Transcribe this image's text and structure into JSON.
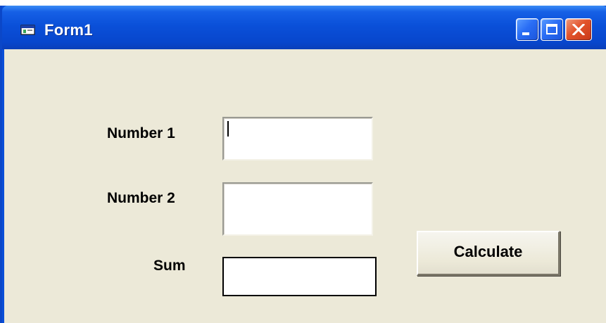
{
  "window": {
    "title": "Form1",
    "icon": "form-app-icon"
  },
  "titlebar_buttons": {
    "minimize_icon": "minimize-icon",
    "maximize_icon": "maximize-icon",
    "close_icon": "close-icon"
  },
  "form": {
    "number1_label": "Number 1",
    "number1_value": "",
    "number2_label": "Number 2",
    "number2_value": "",
    "sum_label": "Sum",
    "sum_value": "",
    "calculate_label": "Calculate"
  },
  "colors": {
    "titlebar_blue": "#0a50d9",
    "client_background": "#ece9d8",
    "close_button_red": "#e2532b"
  }
}
